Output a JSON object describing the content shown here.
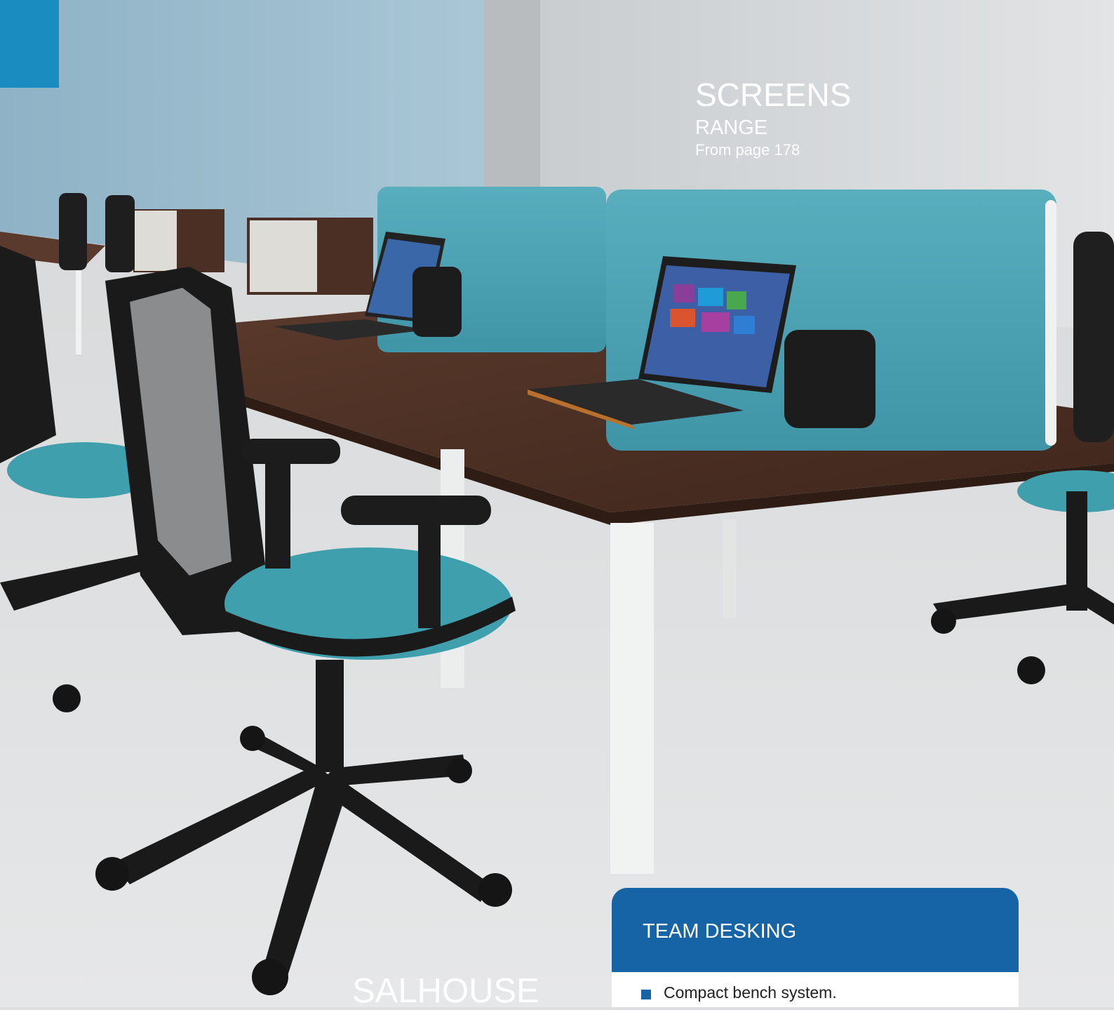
{
  "screens_heading": {
    "title": "SCREENS",
    "subtitle": "RANGE",
    "page_ref": "From page 178"
  },
  "info_card": {
    "title": "TEAM DESKING",
    "features": [
      "Compact bench system."
    ]
  },
  "product_name": "SALHOUSE",
  "colors": {
    "tab_blue": "#1a8cc0",
    "card_header_blue": "#1664a6",
    "screen_teal": "#4aa5b6",
    "desk_walnut": "#4a2e22"
  }
}
